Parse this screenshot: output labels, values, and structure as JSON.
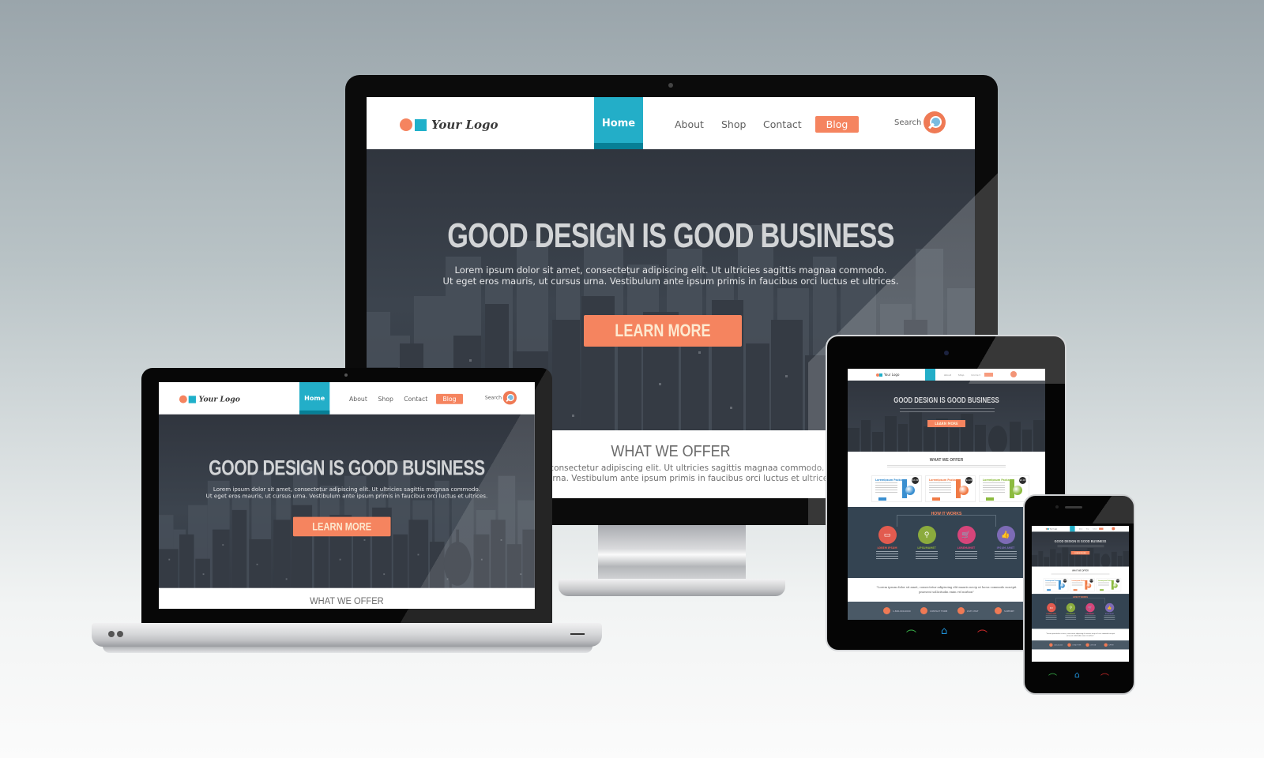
{
  "scene": "Responsive web design mockup shown on desktop monitor, laptop, tablet and smartphone",
  "colors": {
    "accent_teal": "#23aec8",
    "accent_teal_dark": "#077f96",
    "accent_orange": "#f5845f",
    "hero_bg": "#353b44",
    "how_bg": "#344452",
    "footer_bg": "#4a5966"
  },
  "site": {
    "logo_text": "Your Logo",
    "logo_icons": [
      "circle-orange",
      "square-teal"
    ],
    "nav": {
      "home": "Home",
      "about": "About",
      "shop": "Shop",
      "contact": "Contact",
      "blog": "Blog",
      "search_label": "Search",
      "search_icon": "magnifier-icon"
    },
    "hero": {
      "title": "GOOD DESIGN IS GOOD BUSINESS",
      "text_line1": "Lorem ipsum dolor sit amet, consectetur adipiscing elit. Ut ultricies sagittis magnaa commodo.",
      "text_line2": "Ut eget eros mauris, ut cursus urna. Vestibulum ante ipsum primis in faucibus orci luctus et ultrices.",
      "cta": "LEARN MORE"
    },
    "offer": {
      "title": "WHAT WE OFFER",
      "text_line1": "Lorem ipsum dolor sit amet, consectetur adipiscing elit. Ut ultricies sagittis magnaa commodo. Ut eget eros mauris,",
      "text_line2": "ut cursus urna. Vestibulum ante ipsum primis in faucibus orci luctus et ultrices.",
      "packages": [
        {
          "title": "Loremipsum Package",
          "color": "#3a8fd0",
          "price": "$2.99"
        },
        {
          "title": "Loremipsum Package",
          "color": "#f07a45",
          "price": "$2.99"
        },
        {
          "title": "Loremipsum Package",
          "color": "#8cbb3f",
          "price": "$2.99"
        }
      ]
    },
    "how_it_works": {
      "title": "HOW IT WORKS",
      "steps": [
        {
          "label": "LOREM IPSUM",
          "icon": "laptop-icon",
          "color": "#e25b4f",
          "glyph": "▭"
        },
        {
          "label": "LIPSUMAMET",
          "icon": "search-icon",
          "color": "#8bab3d",
          "glyph": "⚲"
        },
        {
          "label": "LOREMAMET",
          "icon": "cart-icon",
          "color": "#d6457a",
          "glyph": "🛒"
        },
        {
          "label": "IPSUM AMET",
          "icon": "thumbs-up-icon",
          "color": "#7d6bb5",
          "glyph": "👍"
        }
      ]
    },
    "quote": "\"Lorem ipsum dolor sit amet, consectetur adipiscing elit mauris necip ut lacus commodo suscipit praesent sollicitudin enim vel mirbon\"",
    "footer": [
      {
        "label": "1-800-000-0000",
        "icon": "phone-icon"
      },
      {
        "label": "CONTACT FORM",
        "icon": "mail-icon"
      },
      {
        "label": "LIVE CHAT",
        "icon": "chat-icon"
      },
      {
        "label": "SUPPORT",
        "icon": "lightbulb-icon"
      }
    ]
  },
  "devices": {
    "monitor": "desktop-monitor",
    "laptop": "laptop",
    "tablet": {
      "buttons": [
        "call-icon",
        "home-icon",
        "end-call-icon"
      ]
    },
    "phone": {
      "buttons": [
        "call-icon",
        "home-icon",
        "end-call-icon"
      ]
    }
  }
}
